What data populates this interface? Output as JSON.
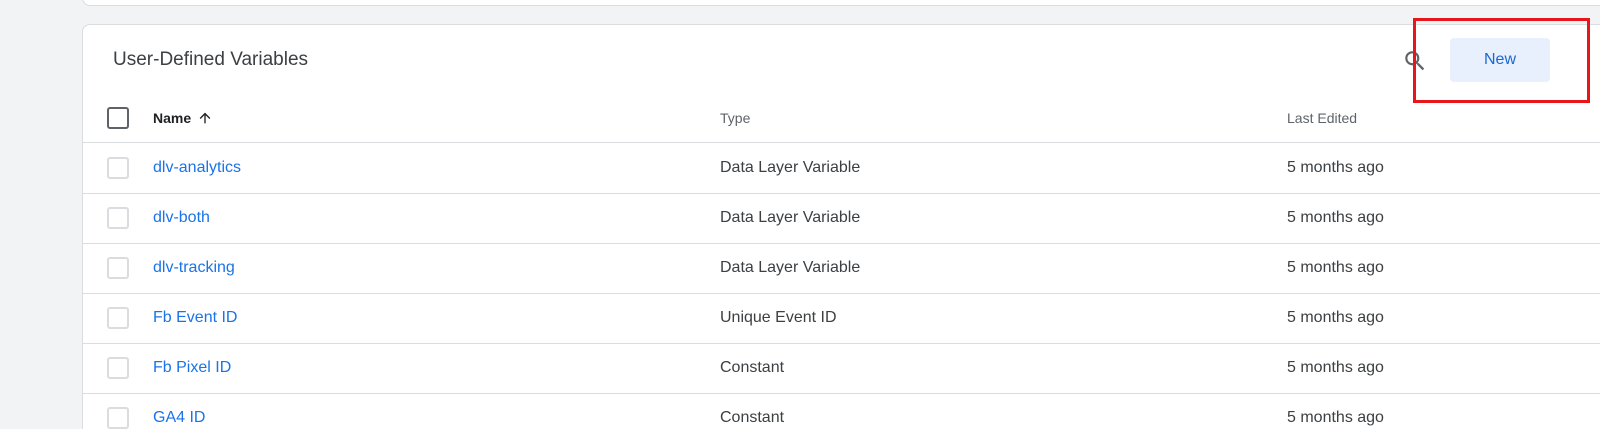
{
  "card": {
    "title": "User-Defined Variables",
    "new_label": "New",
    "search_icon": "search-icon"
  },
  "table": {
    "columns": {
      "name": "Name",
      "type": "Type",
      "last_edited": "Last Edited"
    },
    "sort_icon": "arrow-up-icon",
    "rows": [
      {
        "name": "dlv-analytics",
        "type": "Data Layer Variable",
        "last_edited": "5 months ago"
      },
      {
        "name": "dlv-both",
        "type": "Data Layer Variable",
        "last_edited": "5 months ago"
      },
      {
        "name": "dlv-tracking",
        "type": "Data Layer Variable",
        "last_edited": "5 months ago"
      },
      {
        "name": "Fb Event ID",
        "type": "Unique Event ID",
        "last_edited": "5 months ago"
      },
      {
        "name": "Fb Pixel ID",
        "type": "Constant",
        "last_edited": "5 months ago"
      },
      {
        "name": "GA4 ID",
        "type": "Constant",
        "last_edited": "5 months ago"
      }
    ]
  },
  "colors": {
    "accent": "#1a73e8",
    "button_bg": "#e8f0fe",
    "highlight": "#e8151b"
  }
}
